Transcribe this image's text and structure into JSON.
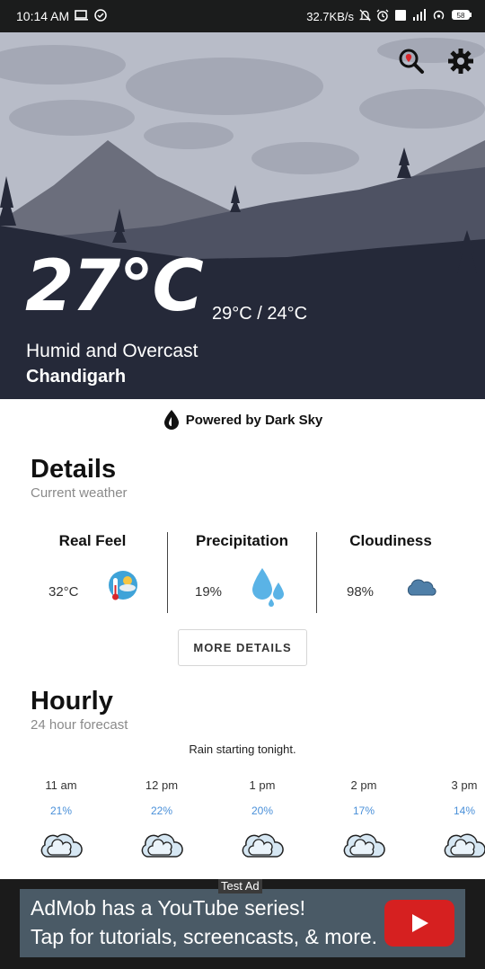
{
  "status_bar": {
    "time": "10:14 AM",
    "net_speed": "32.7KB/s",
    "icons": [
      "screen-icon",
      "check-circle-icon",
      "bell-off-icon",
      "alarm-icon",
      "volte-icon",
      "signal-icon",
      "wifi-hotspot-icon",
      "battery-icon"
    ],
    "battery": "58"
  },
  "hero": {
    "temperature": "27°C",
    "min_max": "29°C / 24°C",
    "condition": "Humid and Overcast",
    "location": "Chandigarh",
    "colors": {
      "sky": "#b8bcc8",
      "mountain": "#6b6e7c",
      "ground": "#252939"
    }
  },
  "powered_by": "Powered by Dark Sky",
  "details": {
    "title": "Details",
    "subtitle": "Current weather",
    "items": [
      {
        "label": "Real Feel",
        "value": "32°C",
        "icon": "thermometer-sun-icon"
      },
      {
        "label": "Precipitation",
        "value": "19%",
        "icon": "water-drops-icon"
      },
      {
        "label": "Cloudiness",
        "value": "98%",
        "icon": "cloud-icon"
      }
    ],
    "more_button": "MORE DETAILS"
  },
  "hourly": {
    "title": "Hourly",
    "subtitle": "24 hour forecast",
    "summary": "Rain starting tonight.",
    "items": [
      {
        "time": "11 am",
        "precip": "21%",
        "icon": "rain-cloud-icon"
      },
      {
        "time": "12 pm",
        "precip": "22%",
        "icon": "rain-cloud-icon"
      },
      {
        "time": "1 pm",
        "precip": "20%",
        "icon": "rain-cloud-icon"
      },
      {
        "time": "2 pm",
        "precip": "17%",
        "icon": "rain-cloud-icon"
      },
      {
        "time": "3 pm",
        "precip": "14%",
        "icon": "rain-cloud-icon"
      }
    ]
  },
  "ad": {
    "tag": "Test Ad",
    "line1": "AdMob has a YouTube series!",
    "line2": "Tap for tutorials, screencasts, & more."
  }
}
